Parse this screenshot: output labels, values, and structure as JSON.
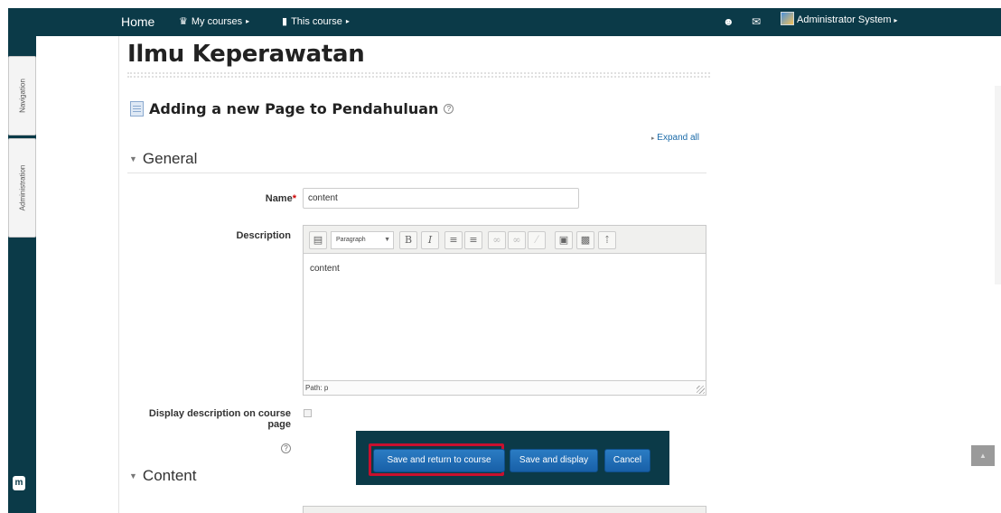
{
  "navbar": {
    "home": "Home",
    "my_courses": "My courses",
    "this_course": "This course",
    "user": "Administrator System"
  },
  "dock": {
    "navigation": "Navigation",
    "administration": "Administration"
  },
  "course": {
    "title": "Ilmu Keperawatan"
  },
  "page": {
    "heading": "Adding a new Page to Pendahuluan",
    "expand_all": "Expand all"
  },
  "general": {
    "legend": "General",
    "name_label": "Name",
    "name_required": "*",
    "name_value": "content",
    "description_label": "Description",
    "editor_format": "Paragraph",
    "editor_content": "content",
    "editor_path": "Path: p",
    "display_description_label_1": "Display description on course",
    "display_description_label_2": "page"
  },
  "content_section": {
    "legend": "Content"
  },
  "actions": {
    "save_return": "Save and return to course",
    "save_display": "Save and display",
    "cancel": "Cancel"
  },
  "colors": {
    "nav_dark": "#0b3a48",
    "button_blue": "#1e6db7",
    "highlight": "#c8102e"
  }
}
